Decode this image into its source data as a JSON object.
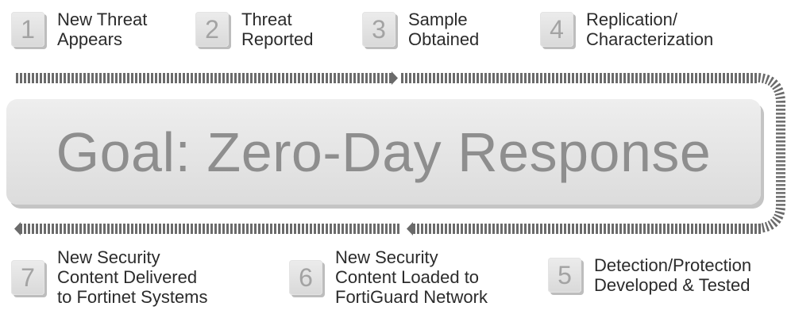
{
  "goal": {
    "text": "Goal: Zero-Day Response"
  },
  "steps_top": [
    {
      "number": "1",
      "lines": [
        "New Threat",
        "Appears"
      ]
    },
    {
      "number": "2",
      "lines": [
        "Threat",
        "Reported"
      ]
    },
    {
      "number": "3",
      "lines": [
        "Sample",
        "Obtained"
      ]
    },
    {
      "number": "4",
      "lines": [
        "Replication/",
        "Characterization"
      ]
    }
  ],
  "steps_bottom": [
    {
      "number": "7",
      "lines": [
        "New Security",
        "Content Delivered",
        "to Fortinet Systems"
      ]
    },
    {
      "number": "6",
      "lines": [
        "New Security",
        "Content Loaded to",
        "FortiGuard Network"
      ]
    },
    {
      "number": "5",
      "lines": [
        "Detection/Protection",
        "Developed & Tested"
      ]
    }
  ],
  "colors": {
    "stripe": "#6b6b6b",
    "badge_text": "#a3a3a3",
    "goal_text": "#8e8e8e"
  }
}
